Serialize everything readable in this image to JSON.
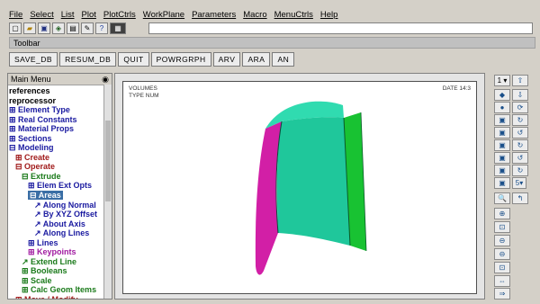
{
  "menubar": [
    "File",
    "Select",
    "List",
    "Plot",
    "PlotCtrls",
    "WorkPlane",
    "Parameters",
    "Macro",
    "MenuCtrls",
    "Help"
  ],
  "toolbar_title": "Toolbar",
  "toolbar_buttons": [
    "SAVE_DB",
    "RESUM_DB",
    "QUIT",
    "POWRGRPH",
    "ARV",
    "ARA",
    "AN"
  ],
  "main_menu": {
    "title": "Main Menu",
    "items": [
      {
        "label": "references",
        "color": "#000000",
        "indent": 0
      },
      {
        "label": "reprocessor",
        "color": "#000000",
        "indent": 0
      },
      {
        "label": "⊞ Element Type",
        "color": "#1a1aa0",
        "indent": 0
      },
      {
        "label": "⊞ Real Constants",
        "color": "#1a1aa0",
        "indent": 0
      },
      {
        "label": "⊞ Material Props",
        "color": "#1a1aa0",
        "indent": 0
      },
      {
        "label": "⊞ Sections",
        "color": "#1a1aa0",
        "indent": 0
      },
      {
        "label": "⊟ Modeling",
        "color": "#1a1aa0",
        "indent": 0
      },
      {
        "label": "⊞ Create",
        "color": "#a01a1a",
        "indent": 1
      },
      {
        "label": "⊟ Operate",
        "color": "#a01a1a",
        "indent": 1
      },
      {
        "label": "⊟ Extrude",
        "color": "#1a7a1a",
        "indent": 2
      },
      {
        "label": "⊞ Elem Ext Opts",
        "color": "#1a1aa0",
        "indent": 3
      },
      {
        "label": "⊟ Areas",
        "color": "#ffffff",
        "indent": 3,
        "selected": true
      },
      {
        "label": "↗ Along Normal",
        "color": "#1a1aa0",
        "indent": 4
      },
      {
        "label": "↗ By XYZ Offset",
        "color": "#1a1aa0",
        "indent": 4
      },
      {
        "label": "↗ About Axis",
        "color": "#1a1aa0",
        "indent": 4
      },
      {
        "label": "↗ Along Lines",
        "color": "#1a1aa0",
        "indent": 4
      },
      {
        "label": "⊞ Lines",
        "color": "#1a1aa0",
        "indent": 3
      },
      {
        "label": "⊞ Keypoints",
        "color": "#a01aa0",
        "indent": 3
      },
      {
        "label": "↗ Extend Line",
        "color": "#1a7a1a",
        "indent": 2
      },
      {
        "label": "⊞ Booleans",
        "color": "#1a7a1a",
        "indent": 2
      },
      {
        "label": "⊞ Scale",
        "color": "#1a7a1a",
        "indent": 2
      },
      {
        "label": "⊞ Calc Geom Items",
        "color": "#1a7a1a",
        "indent": 2
      },
      {
        "label": "⊞ Move / Modify",
        "color": "#a01a1a",
        "indent": 1
      }
    ]
  },
  "viewport": {
    "label_tl1": "VOLUMES",
    "label_tl2": "TYPE NUM",
    "label_tr": "DATE 14:3"
  },
  "colors": {
    "teal_front": "#1fc79b",
    "teal_top": "#30dbb0",
    "green_side": "#18c232",
    "magenta_side": "#d21fa6"
  },
  "right_panel_icons": [
    "1-dropdown",
    "up-icon",
    "view-iso-icon",
    "zoom-icon",
    "rotate-icon",
    "fit-icon",
    "pan-icon",
    "dynamic-icon"
  ]
}
